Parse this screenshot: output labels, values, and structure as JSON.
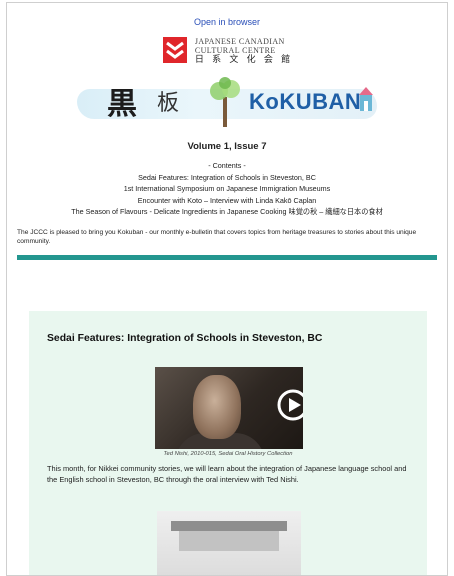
{
  "header": {
    "open_in_browser": "Open in browser",
    "logo": {
      "line1": "JAPANESE CANADIAN",
      "line2": "CULTURAL CENTRE",
      "line3": "日 系 文 化 会 館",
      "mark_color": "#e0262b"
    }
  },
  "banner": {
    "kanji": "黒",
    "kanji2": "板",
    "wordmark": "KoKUBAN"
  },
  "issue": {
    "volume": "Volume 1, Issue 7"
  },
  "contents": {
    "heading": "- Contents -",
    "items": [
      "Sedai Features: Integration of Schools in Steveston, BC",
      "1st International Symposium on Japanese Immigration Museums",
      "Encounter with Koto – Interview with Linda Kakō Caplan",
      "The Season of Flavours - Delicate Ingredients in Japanese Cooking 味覚の秋 – 繊細な日本の食材"
    ]
  },
  "intro": "The JCCC is pleased to bring you Kokuban - our monthly e-bulletin that covers topics from heritage treasures to stories about this unique community.",
  "colors": {
    "teal_bar": "#23968f",
    "panel_bg": "#e9f7ef",
    "link": "#2a4fb8"
  },
  "feature": {
    "title": "Sedai Features: Integration of Schools in Steveston, BC",
    "video_caption": "Ted Nishi, 2010-015, Sedai Oral History Collection",
    "body": "This month, for Nikkei community stories, we will learn about the integration of Japanese language school and the English school in Steveston, BC through the oral interview with Ted Nishi."
  }
}
